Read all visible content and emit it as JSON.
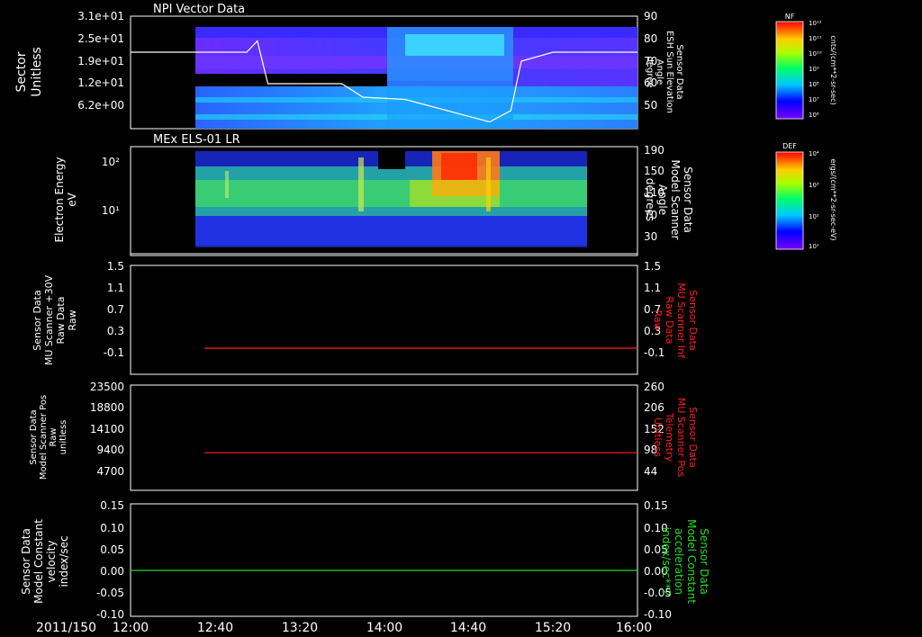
{
  "colors": {
    "background": "#000000",
    "frame": "#ffffff",
    "red_series": "#ff2020",
    "green_series": "#22dd22",
    "white_trace": "#ffffff"
  },
  "time_axis": {
    "date_label": "2011/150",
    "ticks": [
      "12:00",
      "12:40",
      "13:20",
      "14:00",
      "14:40",
      "15:20",
      "16:00"
    ]
  },
  "chart_data": [
    {
      "type": "heatmap",
      "title": "NPI Vector Data",
      "ylabel_left": [
        "Sector",
        "Unitless"
      ],
      "ylabel_right": [
        "Sensor Data",
        "ESH Sun Elevation",
        "Angle",
        "degree"
      ],
      "y_ticks_left": [
        "3.1e+01",
        "2.5e+01",
        "1.9e+01",
        "1.2e+01",
        "6.2e+00"
      ],
      "y_ticks_right": [
        "90",
        "80",
        "70",
        "60",
        "50"
      ],
      "y_right_range": [
        40,
        90
      ],
      "colorbar": {
        "title": "NF",
        "unit": "cnts/(cm**2-sr-sec)",
        "ticks": [
          "10¹²",
          "10¹¹",
          "10¹⁰",
          "10⁹",
          "10⁸",
          "10⁷",
          "10⁶"
        ]
      },
      "overlay_series": {
        "name": "ESH Sun Elevation Angle",
        "x": [
          "12:00",
          "12:55",
          "13:00",
          "13:05",
          "13:40",
          "13:50",
          "14:10",
          "14:30",
          "14:50",
          "15:00",
          "15:05",
          "15:20",
          "16:00"
        ],
        "y": [
          74,
          74,
          79,
          60,
          60,
          54,
          53,
          48,
          43,
          48,
          70,
          74,
          74
        ]
      }
    },
    {
      "type": "heatmap",
      "title": "MEx ELS-01 LR",
      "ylabel_left": [
        "Electron Energy",
        "eV"
      ],
      "ylabel_right": [
        "Sensor Data",
        "Model Scanner",
        "Angle",
        "degrees"
      ],
      "y_ticks_left": [
        "10²",
        "10¹"
      ],
      "y_ticks_right": [
        "190",
        "150",
        "110",
        "70",
        "30"
      ],
      "y_right_range": [
        10,
        190
      ],
      "colorbar": {
        "title": "DEF",
        "unit": "ergs/(cm**2-sr-sec-eV)",
        "ticks": [
          "10⁴",
          "10³",
          "10²",
          "10¹"
        ]
      },
      "overlay_series": {
        "name": "Model Scanner Angle",
        "x": [
          "12:00",
          "16:00"
        ],
        "y": [
          13,
          13
        ]
      }
    },
    {
      "type": "line",
      "ylabel_left": [
        "Sensor Data",
        "MU Scanner +30V",
        "Raw Data",
        "Raw"
      ],
      "ylabel_right": [
        "Sensor Data",
        "MU Scanner Inf",
        "Raw Data",
        "Raw"
      ],
      "y_ticks_left": [
        "1.5",
        "1.1",
        "0.7",
        "0.3",
        "-0.1"
      ],
      "y_ticks_right": [
        "1.5",
        "1.1",
        "0.7",
        "0.3",
        "-0.1"
      ],
      "ylim": [
        -0.5,
        1.5
      ],
      "series": [
        {
          "x": [
            "12:35",
            "16:00"
          ],
          "y": [
            -0.02,
            -0.02
          ]
        }
      ]
    },
    {
      "type": "line",
      "ylabel_left": [
        "Sensor Data",
        "Model Scanner Pos",
        "Raw",
        "unitless"
      ],
      "ylabel_right": [
        "Sensor Data",
        "MU Scanner Pos",
        "Telemetry",
        "Unitless"
      ],
      "y_ticks_left": [
        "23500",
        "18800",
        "14100",
        "9400",
        "4700"
      ],
      "y_ticks_right": [
        "260",
        "206",
        "152",
        "98",
        "44"
      ],
      "ylim": [
        0,
        23500
      ],
      "series": [
        {
          "x": [
            "12:35",
            "16:00"
          ],
          "y": [
            8400,
            8400
          ]
        }
      ]
    },
    {
      "type": "line",
      "ylabel_left": [
        "Sensor Data",
        "Model Constant",
        "velocity",
        "index/sec"
      ],
      "ylabel_right": [
        "Sensor Data",
        "Model Constant",
        "acceleration",
        "index/sec**2"
      ],
      "y_ticks_left": [
        "0.15",
        "0.10",
        "0.05",
        "0.00",
        "-0.05",
        "-0.10"
      ],
      "y_ticks_right": [
        "0.15",
        "0.10",
        "0.05",
        "0.00",
        "-0.05",
        "-0.10"
      ],
      "ylim": [
        -0.1,
        0.15
      ],
      "series": [
        {
          "x": [
            "12:00",
            "16:00"
          ],
          "y": [
            0,
            0
          ]
        }
      ]
    }
  ]
}
